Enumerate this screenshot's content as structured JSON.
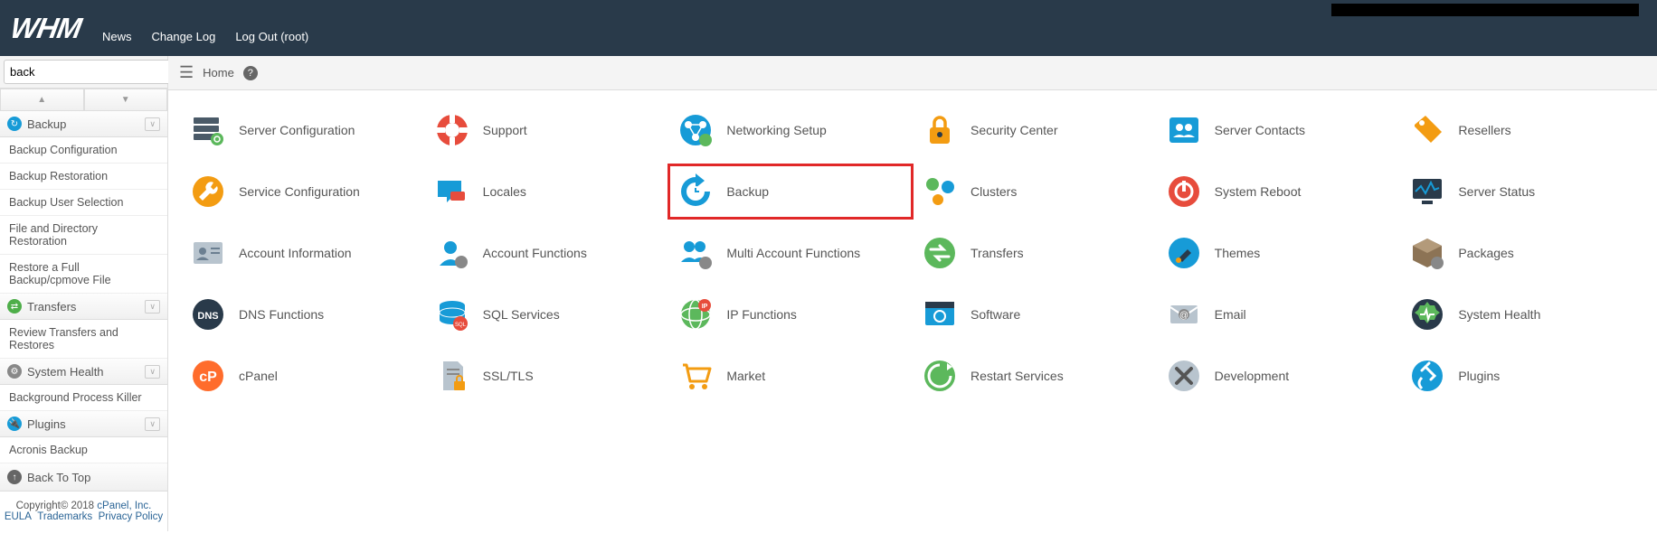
{
  "header": {
    "logo": "WHM",
    "nav": {
      "news": "News",
      "change_log": "Change Log",
      "logout": "Log Out (root)"
    }
  },
  "search": {
    "value": "back"
  },
  "breadcrumb": {
    "home": "Home"
  },
  "sidebar": {
    "backup": {
      "header": "Backup",
      "items": [
        "Backup Configuration",
        "Backup Restoration",
        "Backup User Selection",
        "File and Directory Restoration",
        "Restore a Full Backup/cpmove File"
      ]
    },
    "transfers": {
      "header": "Transfers",
      "items": [
        "Review Transfers and Restores"
      ]
    },
    "system_health": {
      "header": "System Health",
      "items": [
        "Background Process Killer"
      ]
    },
    "plugins": {
      "header": "Plugins",
      "items": [
        "Acronis Backup"
      ]
    },
    "back_to_top": "Back To Top"
  },
  "footer": {
    "copyright": "Copyright© 2018 ",
    "cpanel": "cPanel, Inc.",
    "eula": "EULA",
    "trademarks": "Trademarks",
    "privacy": "Privacy Policy"
  },
  "tiles": {
    "r1": [
      "Server Configuration",
      "Support",
      "Networking Setup",
      "Security Center",
      "Server Contacts",
      "Resellers"
    ],
    "r2": [
      "Service Configuration",
      "Locales",
      "Backup",
      "Clusters",
      "System Reboot",
      "Server Status"
    ],
    "r3": [
      "Account Information",
      "Account Functions",
      "Multi Account Functions",
      "Transfers",
      "Themes",
      "Packages"
    ],
    "r4": [
      "DNS Functions",
      "SQL Services",
      "IP Functions",
      "Software",
      "Email",
      "System Health"
    ],
    "r5": [
      "cPanel",
      "SSL/TLS",
      "Market",
      "Restart Services",
      "Development",
      "Plugins"
    ]
  },
  "colors": {
    "accent_blue": "#179bd7",
    "header_bg": "#293a4a",
    "highlight": "#e12828"
  }
}
